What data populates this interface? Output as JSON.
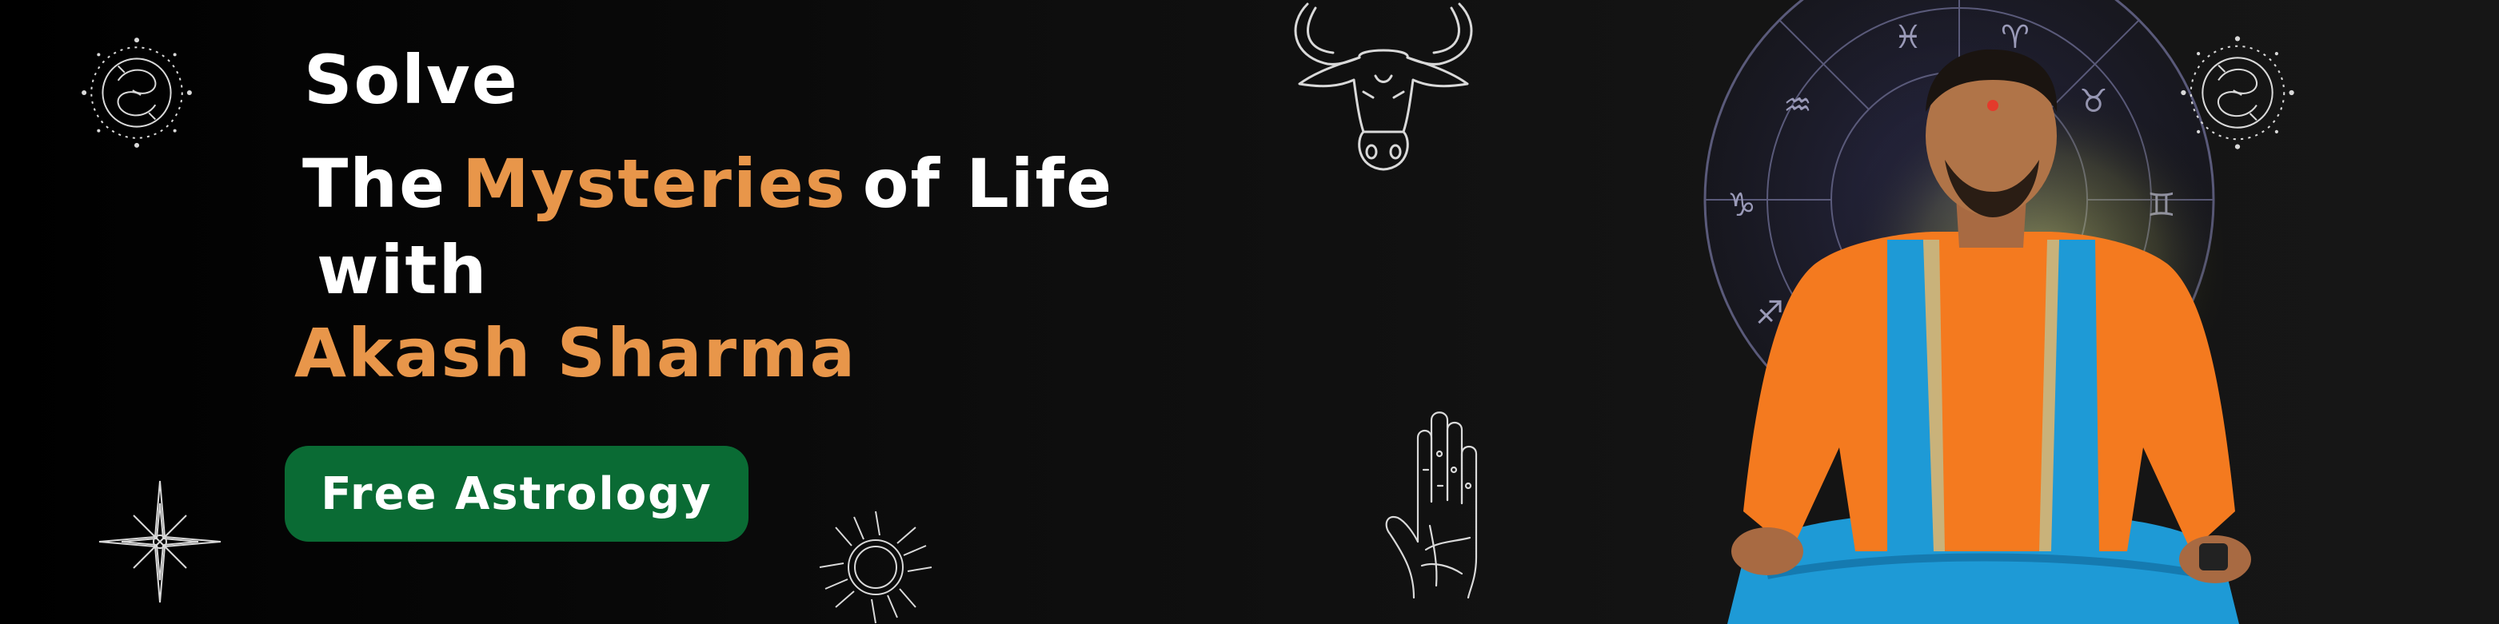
{
  "banner": {
    "headline": {
      "line1": "Solve",
      "line2_part1": "The",
      "line2_accent": "Mysteries",
      "line2_part2": "of Life",
      "line3": "with",
      "line4": "Akash Sharma"
    },
    "cta_label": "Free Astrology"
  },
  "colors": {
    "background": "#000000",
    "accent": "#e8964a",
    "cta_background": "#0a6b34",
    "text": "#ffffff",
    "robe": "#f47a1f",
    "scarf": "#1e9ad6"
  },
  "icons": [
    "pisces-zodiac-icon",
    "taurus-bull-icon",
    "palmistry-hand-icon",
    "sparkle-star-icon",
    "sun-icon",
    "zodiac-wheel-icon"
  ]
}
